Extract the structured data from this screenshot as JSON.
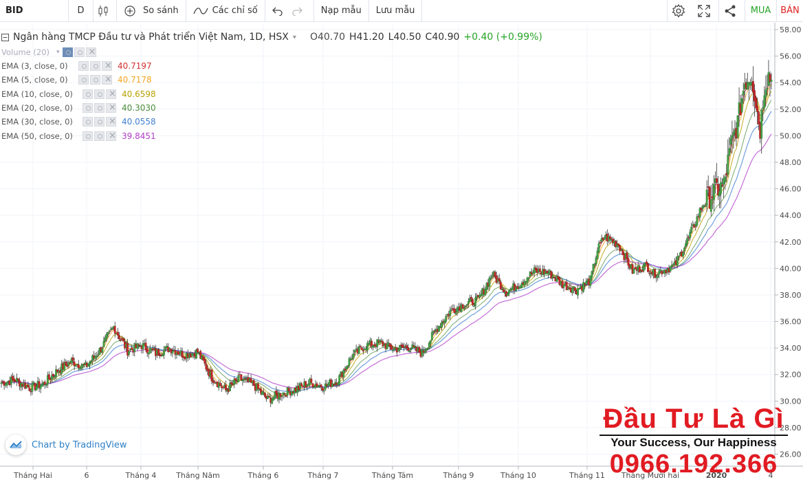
{
  "toolbar": {
    "symbol": "BID",
    "interval": "D",
    "compare_label": "So sánh",
    "indicators_label": "Các chỉ số",
    "load_label": "Nạp mẫu",
    "save_label": "Lưu mẫu",
    "buy_label": "MUA",
    "sell_label": "BÁN",
    "icons": [
      "candles-icon",
      "compare-icon",
      "indicators-icon",
      "undo-icon",
      "redo-icon",
      "settings-icon",
      "fullscreen-icon",
      "share-icon"
    ]
  },
  "legend": {
    "title": "Ngân hàng TMCP Đầu tư và Phát triển Việt Nam, 1D, HSX",
    "open": "O40.70",
    "high": "H41.20",
    "low": "L40.50",
    "close": "C40.90",
    "change": "+0.40 (+0.99%)"
  },
  "studies": [
    {
      "name": "Volume (20)",
      "value": "",
      "color": "#aaaaaa"
    },
    {
      "name": "EMA (3, close, 0)",
      "value": "40.7197",
      "color": "#d32f2f"
    },
    {
      "name": "EMA (5, close, 0)",
      "value": "40.7178",
      "color": "#f5a623"
    },
    {
      "name": "EMA (10, close, 0)",
      "value": "40.6598",
      "color": "#b8a000"
    },
    {
      "name": "EMA (20, close, 0)",
      "value": "40.3030",
      "color": "#4a8c3a"
    },
    {
      "name": "EMA (30, close, 0)",
      "value": "40.0558",
      "color": "#3f7fd0"
    },
    {
      "name": "EMA (50, close, 0)",
      "value": "39.8451",
      "color": "#b23cc9"
    }
  ],
  "badge": {
    "label": "Chart by TradingView"
  },
  "watermark": {
    "line1": "Đầu Tư Là Gì",
    "line2": "Your Success, Our Happiness",
    "line3": "0966.192.366"
  },
  "chart_data": {
    "type": "candlestick",
    "y_axis_ticks": [
      "58.00",
      "56.00",
      "54.00",
      "52.00",
      "50.00",
      "48.00",
      "46.00",
      "44.00",
      "42.00",
      "40.00",
      "38.00",
      "36.00",
      "34.00",
      "32.00",
      "30.00",
      "28.00",
      "26.00"
    ],
    "ylim": [
      25.2,
      58.4
    ],
    "x_axis_labels": [
      "Tháng Hai",
      "6",
      "Tháng 4",
      "Tháng Năm",
      "Tháng 6",
      "Tháng 7",
      "Tháng Tám",
      "Tháng 9",
      "Tháng 10",
      "Tháng 11",
      "Tháng Mười hai",
      "2020",
      "4"
    ],
    "colors": {
      "up": "#26a69a",
      "down": "#ef5350",
      "candle_body": "#4caf50"
    },
    "close_anchors": [
      [
        0,
        31.4
      ],
      [
        10,
        31.6
      ],
      [
        20,
        31.0
      ],
      [
        30,
        31.3
      ],
      [
        40,
        32.3
      ],
      [
        50,
        33.0
      ],
      [
        60,
        32.6
      ],
      [
        70,
        33.8
      ],
      [
        80,
        35.6
      ],
      [
        90,
        33.8
      ],
      [
        100,
        34.2
      ],
      [
        110,
        33.6
      ],
      [
        120,
        34.0
      ],
      [
        130,
        33.5
      ],
      [
        140,
        33.7
      ],
      [
        150,
        31.8
      ],
      [
        160,
        30.8
      ],
      [
        170,
        31.7
      ],
      [
        180,
        31.2
      ],
      [
        190,
        30.1
      ],
      [
        200,
        30.6
      ],
      [
        210,
        30.9
      ],
      [
        220,
        31.4
      ],
      [
        230,
        31.1
      ],
      [
        240,
        31.6
      ],
      [
        250,
        33.4
      ],
      [
        260,
        34.2
      ],
      [
        270,
        34.4
      ],
      [
        280,
        33.9
      ],
      [
        290,
        34.1
      ],
      [
        300,
        33.6
      ],
      [
        310,
        35.4
      ],
      [
        320,
        36.8
      ],
      [
        330,
        37.3
      ],
      [
        340,
        37.6
      ],
      [
        350,
        39.6
      ],
      [
        360,
        38.2
      ],
      [
        370,
        38.9
      ],
      [
        380,
        39.8
      ],
      [
        390,
        39.7
      ],
      [
        400,
        38.8
      ],
      [
        410,
        38.4
      ],
      [
        420,
        39.1
      ],
      [
        425,
        41.4
      ],
      [
        430,
        42.4
      ],
      [
        440,
        41.8
      ],
      [
        450,
        39.8
      ],
      [
        460,
        40.2
      ],
      [
        465,
        39.6
      ],
      [
        470,
        39.8
      ],
      [
        480,
        40.2
      ],
      [
        490,
        42.3
      ],
      [
        500,
        44.8
      ],
      [
        510,
        46.0
      ],
      [
        515,
        46.2
      ],
      [
        520,
        49.2
      ],
      [
        525,
        51.0
      ],
      [
        530,
        54.1
      ],
      [
        535,
        54.6
      ],
      [
        538,
        52.5
      ],
      [
        541,
        50.5
      ],
      [
        544,
        53.8
      ],
      [
        547,
        54.6
      ],
      [
        549,
        54.2
      ]
    ],
    "ema_last": {
      "3": 40.7197,
      "5": 40.7178,
      "10": 40.6598,
      "20": 40.303,
      "30": 40.0558,
      "50": 39.8451
    }
  }
}
